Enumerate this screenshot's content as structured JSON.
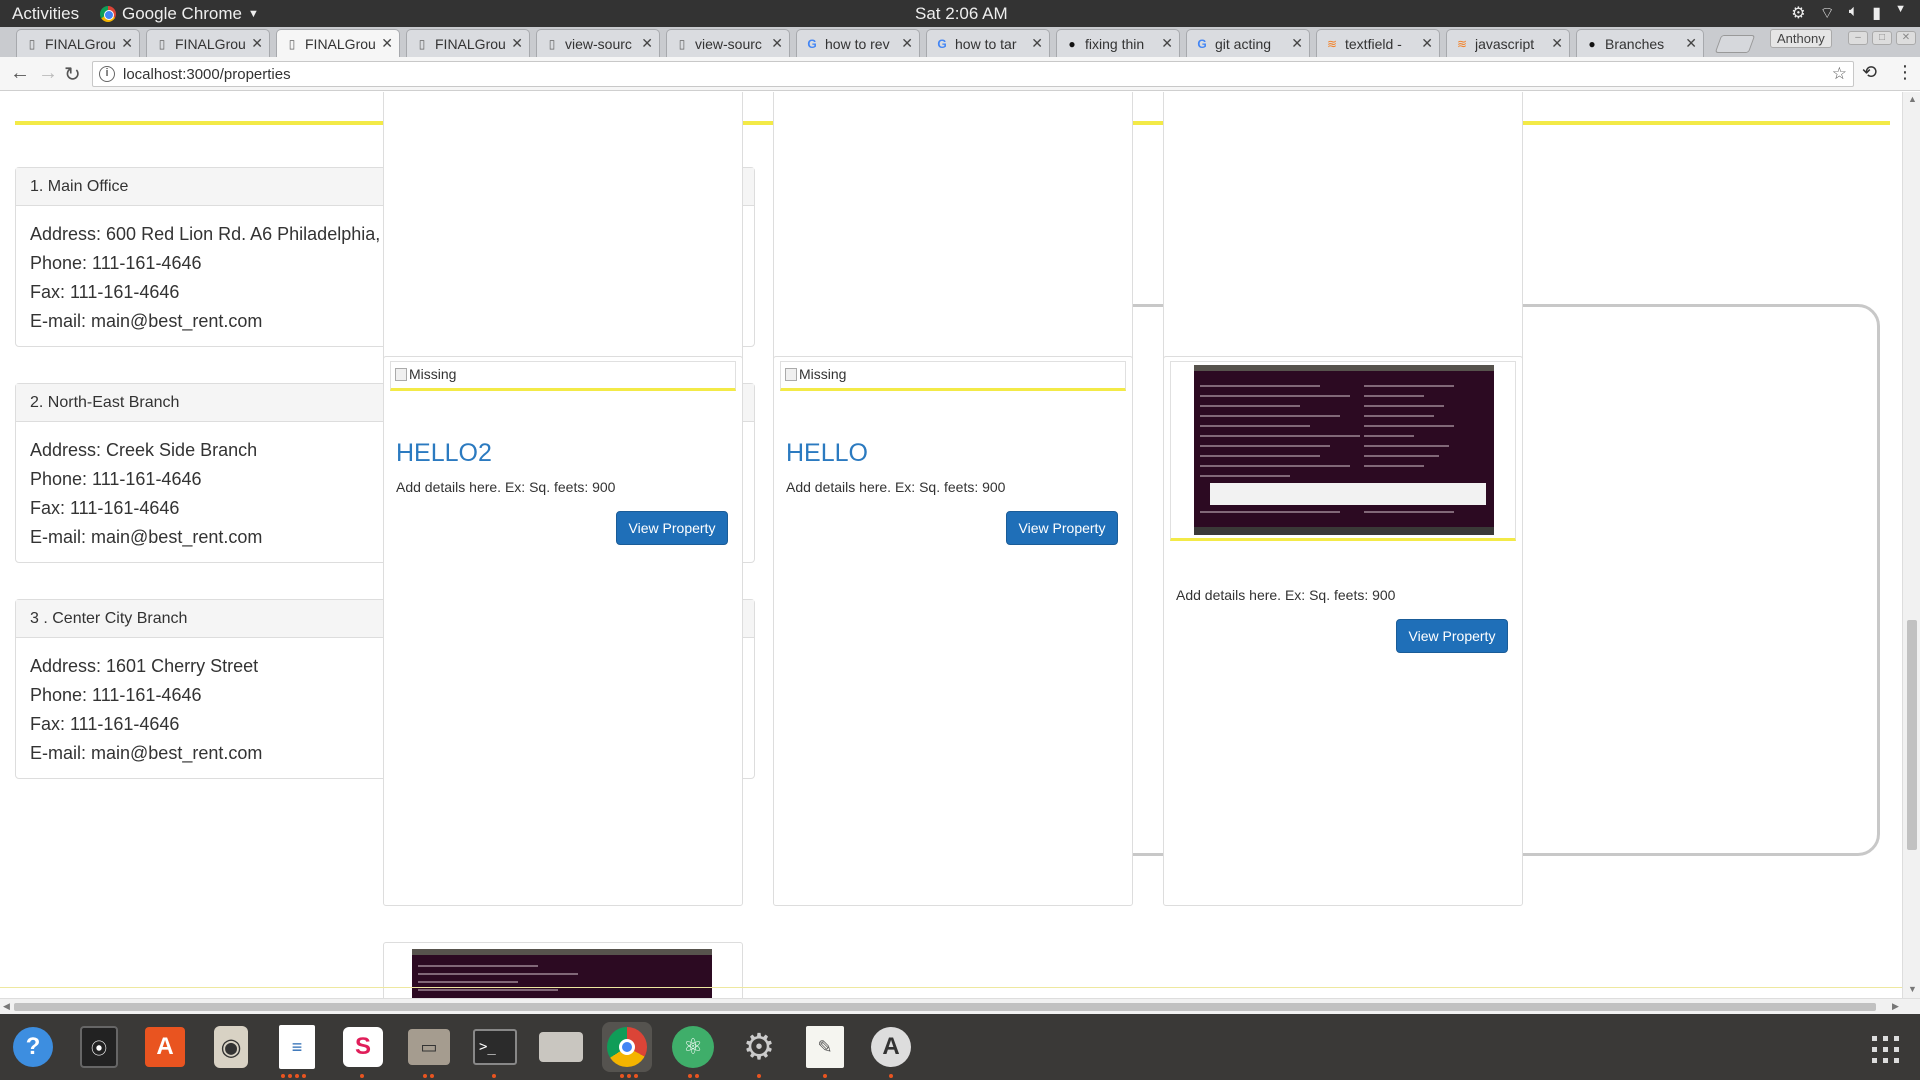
{
  "topbar": {
    "activities": "Activities",
    "app_name": "Google Chrome",
    "clock": "Sat  2:06 AM"
  },
  "tabs": [
    {
      "label": "FINALGrou",
      "icon": "page-icon"
    },
    {
      "label": "FINALGrou",
      "icon": "page-icon"
    },
    {
      "label": "FINALGrou",
      "icon": "page-icon",
      "active": true
    },
    {
      "label": "FINALGrou",
      "icon": "page-icon"
    },
    {
      "label": "view-sourc",
      "icon": "page-icon"
    },
    {
      "label": "view-sourc",
      "icon": "page-icon"
    },
    {
      "label": "how to rev",
      "icon": "google-icon"
    },
    {
      "label": "how to tar",
      "icon": "google-icon"
    },
    {
      "label": "fixing thin",
      "icon": "github-icon"
    },
    {
      "label": "git acting",
      "icon": "google-icon"
    },
    {
      "label": "textfield -",
      "icon": "stackoverflow-icon"
    },
    {
      "label": "javascript",
      "icon": "stackoverflow-icon"
    },
    {
      "label": "Branches",
      "icon": "github-icon"
    }
  ],
  "profile_name": "Anthony",
  "address_bar": {
    "url": "localhost:3000/properties"
  },
  "offices": [
    {
      "title": "1. Main Office",
      "address": "Address: 600 Red Lion Rd. A6 Philadelphia,",
      "phone": "Phone: 111-161-4646",
      "fax": "Fax: 111-161-4646",
      "email": "E-mail: main@best_rent.com"
    },
    {
      "title": "2. North-East Branch",
      "address": "Address: Creek Side Branch",
      "phone": "Phone: 111-161-4646",
      "fax": "Fax: 111-161-4646",
      "email": "E-mail: main@best_rent.com"
    },
    {
      "title": "3 . Center City Branch",
      "address": "Address: 1601 Cherry Street",
      "phone": "Phone: 111-161-4646",
      "fax": "Fax: 111-161-4646",
      "email": "E-mail: main@best_rent.com"
    }
  ],
  "properties": [
    {
      "image_alt": "Missing",
      "title": "HELLO2",
      "details": "Add details here. Ex: Sq. feets: 900",
      "button": "View Property"
    },
    {
      "image_alt": "Missing",
      "title": "HELLO",
      "details": "Add details here. Ex: Sq. feets: 900",
      "button": "View Property"
    },
    {
      "image_alt": "",
      "title": "",
      "details": "Add details here. Ex: Sq. feets: 900",
      "button": "View Property"
    }
  ],
  "launcher_icons": [
    "help-icon",
    "safe-icon",
    "software-center-icon",
    "speaker-icon",
    "writer-icon",
    "slack-icon",
    "files-icon",
    "terminal-icon",
    "scanner-icon",
    "chrome-icon",
    "atom-icon",
    "settings-icon",
    "text-editor-icon",
    "updater-icon"
  ],
  "colors": {
    "accent_yellow": "#f3ea47",
    "button_blue": "#1f6fb8",
    "title_blue": "#2b7ac0",
    "launcher_bg": "#3a3937"
  }
}
